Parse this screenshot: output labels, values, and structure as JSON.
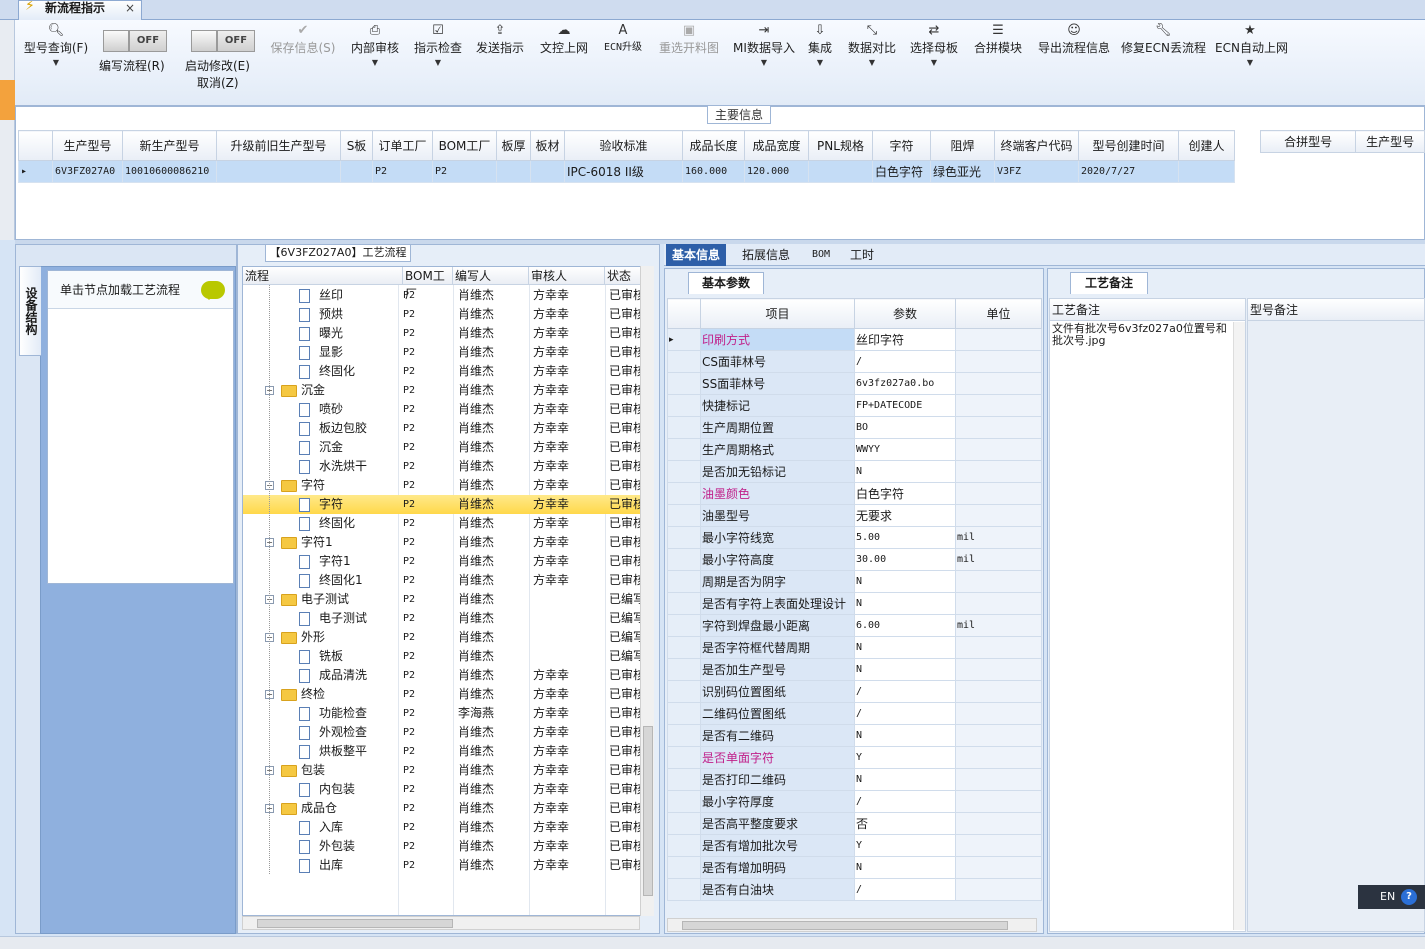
{
  "tab": {
    "title": "新流程指示",
    "close": "×"
  },
  "toolbar": {
    "query": "型号查询(F)",
    "edit_flow": "编写流程(R)",
    "auto_modify": "启动修改(E)",
    "cancel": "取消(Z)",
    "toggle_off": "OFF",
    "save": "保存信息(S)",
    "internal_review": "内部审核",
    "instruction_check": "指示检查",
    "send_instruction": "发送指示",
    "doc_control_upload": "文控上网",
    "ecn_upgrade": "ECN升级",
    "reselect_cut": "重选开料图",
    "mi_import": "MI数据导入",
    "integrate": "集成",
    "data_compare": "数据对比",
    "select_mother": "选择母板",
    "merge_module": "合拼模块",
    "export_flow": "导出流程信息",
    "fix_ecn_flow": "修复ECN丢流程",
    "ecn_auto_upload": "ECN自动上网"
  },
  "main_info": {
    "title": "主要信息",
    "columns": [
      "生产型号",
      "新生产型号",
      "升级前旧生产型号",
      "S板",
      "订单工厂",
      "BOM工厂",
      "板厚",
      "板材",
      "验收标准",
      "成品长度",
      "成品宽度",
      "PNL规格",
      "字符",
      "阻焊",
      "终端客户代码",
      "型号创建时间",
      "创建人"
    ],
    "row": [
      "6V3FZ027A0",
      "10010600086210",
      "",
      "",
      "P2",
      "P2",
      "",
      "",
      "IPC-6018 II级",
      "160.000",
      "120.000",
      "",
      "白色字符",
      "绿色亚光",
      "V3FZ",
      "2020/7/27",
      ""
    ],
    "side_columns": [
      "合拼型号",
      "生产型号"
    ]
  },
  "device": {
    "tab": "设备结构",
    "hint": "单击节点加载工艺流程"
  },
  "process": {
    "title": "【6V3FZ027A0】工艺流程",
    "columns": [
      "流程",
      "BOM工厂",
      "编写人",
      "审核人",
      "状态"
    ],
    "rows": [
      {
        "name": "丝印",
        "level": 2,
        "bom": "P2",
        "writer": "肖维杰",
        "reviewer": "方幸幸",
        "status": "已审核"
      },
      {
        "name": "预烘",
        "level": 2,
        "bom": "P2",
        "writer": "肖维杰",
        "reviewer": "方幸幸",
        "status": "已审核"
      },
      {
        "name": "曝光",
        "level": 2,
        "bom": "P2",
        "writer": "肖维杰",
        "reviewer": "方幸幸",
        "status": "已审核"
      },
      {
        "name": "显影",
        "level": 2,
        "bom": "P2",
        "writer": "肖维杰",
        "reviewer": "方幸幸",
        "status": "已审核"
      },
      {
        "name": "终固化",
        "level": 2,
        "bom": "P2",
        "writer": "肖维杰",
        "reviewer": "方幸幸",
        "status": "已审核"
      },
      {
        "name": "沉金",
        "level": 1,
        "bom": "P2",
        "writer": "肖维杰",
        "reviewer": "方幸幸",
        "status": "已审核"
      },
      {
        "name": "喷砂",
        "level": 2,
        "bom": "P2",
        "writer": "肖维杰",
        "reviewer": "方幸幸",
        "status": "已审核"
      },
      {
        "name": "板边包胶",
        "level": 2,
        "bom": "P2",
        "writer": "肖维杰",
        "reviewer": "方幸幸",
        "status": "已审核"
      },
      {
        "name": "沉金",
        "level": 2,
        "bom": "P2",
        "writer": "肖维杰",
        "reviewer": "方幸幸",
        "status": "已审核"
      },
      {
        "name": "水洗烘干",
        "level": 2,
        "bom": "P2",
        "writer": "肖维杰",
        "reviewer": "方幸幸",
        "status": "已审核"
      },
      {
        "name": "字符",
        "level": 1,
        "bom": "P2",
        "writer": "肖维杰",
        "reviewer": "方幸幸",
        "status": "已审核"
      },
      {
        "name": "字符",
        "level": 2,
        "bom": "P2",
        "writer": "肖维杰",
        "reviewer": "方幸幸",
        "status": "已审核",
        "selected": true
      },
      {
        "name": "终固化",
        "level": 2,
        "bom": "P2",
        "writer": "肖维杰",
        "reviewer": "方幸幸",
        "status": "已审核"
      },
      {
        "name": "字符1",
        "level": 1,
        "bom": "P2",
        "writer": "肖维杰",
        "reviewer": "方幸幸",
        "status": "已审核"
      },
      {
        "name": "字符1",
        "level": 2,
        "bom": "P2",
        "writer": "肖维杰",
        "reviewer": "方幸幸",
        "status": "已审核"
      },
      {
        "name": "终固化1",
        "level": 2,
        "bom": "P2",
        "writer": "肖维杰",
        "reviewer": "方幸幸",
        "status": "已审核"
      },
      {
        "name": "电子测试",
        "level": 1,
        "bom": "P2",
        "writer": "肖维杰",
        "reviewer": "",
        "status": "已编写"
      },
      {
        "name": "电子测试",
        "level": 2,
        "bom": "P2",
        "writer": "肖维杰",
        "reviewer": "",
        "status": "已编写"
      },
      {
        "name": "外形",
        "level": 1,
        "bom": "P2",
        "writer": "肖维杰",
        "reviewer": "",
        "status": "已编写"
      },
      {
        "name": "铣板",
        "level": 2,
        "bom": "P2",
        "writer": "肖维杰",
        "reviewer": "",
        "status": "已编写"
      },
      {
        "name": "成品清洗",
        "level": 2,
        "bom": "P2",
        "writer": "肖维杰",
        "reviewer": "方幸幸",
        "status": "已审核"
      },
      {
        "name": "终检",
        "level": 1,
        "bom": "P2",
        "writer": "肖维杰",
        "reviewer": "方幸幸",
        "status": "已审核"
      },
      {
        "name": "功能检查",
        "level": 2,
        "bom": "P2",
        "writer": "李海燕",
        "reviewer": "方幸幸",
        "status": "已审核"
      },
      {
        "name": "外观检查",
        "level": 2,
        "bom": "P2",
        "writer": "肖维杰",
        "reviewer": "方幸幸",
        "status": "已审核"
      },
      {
        "name": "烘板整平",
        "level": 2,
        "bom": "P2",
        "writer": "肖维杰",
        "reviewer": "方幸幸",
        "status": "已审核"
      },
      {
        "name": "包装",
        "level": 1,
        "bom": "P2",
        "writer": "肖维杰",
        "reviewer": "方幸幸",
        "status": "已审核"
      },
      {
        "name": "内包装",
        "level": 2,
        "bom": "P2",
        "writer": "肖维杰",
        "reviewer": "方幸幸",
        "status": "已审核"
      },
      {
        "name": "成品仓",
        "level": 1,
        "bom": "P2",
        "writer": "肖维杰",
        "reviewer": "方幸幸",
        "status": "已审核"
      },
      {
        "name": "入库",
        "level": 2,
        "bom": "P2",
        "writer": "肖维杰",
        "reviewer": "方幸幸",
        "status": "已审核"
      },
      {
        "name": "外包装",
        "level": 2,
        "bom": "P2",
        "writer": "肖维杰",
        "reviewer": "方幸幸",
        "status": "已审核"
      },
      {
        "name": "出库",
        "level": 2,
        "bom": "P2",
        "writer": "肖维杰",
        "reviewer": "方幸幸",
        "status": "已审核"
      }
    ]
  },
  "right_tabs": [
    "基本信息",
    "拓展信息",
    "BOM",
    "工时"
  ],
  "basic_params": {
    "tab": "基本参数",
    "columns": [
      "项目",
      "参数",
      "单位"
    ],
    "rows": [
      {
        "item": "印刷方式",
        "value": "丝印字符",
        "unit": "",
        "pink": true,
        "selected": true
      },
      {
        "item": "CS面菲林号",
        "value": "/",
        "unit": ""
      },
      {
        "item": "SS面菲林号",
        "value": "6v3fz027a0.bo",
        "unit": ""
      },
      {
        "item": "快捷标记",
        "value": "FP+DATECODE",
        "unit": ""
      },
      {
        "item": "生产周期位置",
        "value": "BO",
        "unit": ""
      },
      {
        "item": "生产周期格式",
        "value": "WWYY",
        "unit": ""
      },
      {
        "item": "是否加无铅标记",
        "value": "N",
        "unit": ""
      },
      {
        "item": "油墨颜色",
        "value": "白色字符",
        "unit": "",
        "pink": true
      },
      {
        "item": "油墨型号",
        "value": "无要求",
        "unit": ""
      },
      {
        "item": "最小字符线宽",
        "value": "5.00",
        "unit": "mil"
      },
      {
        "item": "最小字符高度",
        "value": "30.00",
        "unit": "mil"
      },
      {
        "item": "周期是否为阴字",
        "value": "N",
        "unit": ""
      },
      {
        "item": "是否有字符上表面处理设计",
        "value": "N",
        "unit": ""
      },
      {
        "item": "字符到焊盘最小距离",
        "value": "6.00",
        "unit": "mil"
      },
      {
        "item": "是否字符框代替周期",
        "value": "N",
        "unit": ""
      },
      {
        "item": "是否加生产型号",
        "value": "N",
        "unit": ""
      },
      {
        "item": "识别码位置图纸",
        "value": "/",
        "unit": ""
      },
      {
        "item": "二维码位置图纸",
        "value": "/",
        "unit": ""
      },
      {
        "item": "是否有二维码",
        "value": "N",
        "unit": ""
      },
      {
        "item": "是否单面字符",
        "value": "Y",
        "unit": "",
        "pink": true
      },
      {
        "item": "是否打印二维码",
        "value": "N",
        "unit": ""
      },
      {
        "item": "最小字符厚度",
        "value": "/",
        "unit": ""
      },
      {
        "item": "是否高平整度要求",
        "value": "否",
        "unit": ""
      },
      {
        "item": "是否有增加批次号",
        "value": "Y",
        "unit": ""
      },
      {
        "item": "是否有增加明码",
        "value": "N",
        "unit": ""
      },
      {
        "item": "是否有白油块",
        "value": "/",
        "unit": ""
      }
    ]
  },
  "notes": {
    "tab": "工艺备注",
    "col1": "工艺备注",
    "col2": "型号备注",
    "text": "文件有批次号6v3fz027a0位置号和批次号.jpg"
  },
  "lang": {
    "code": "EN",
    "help": "?"
  }
}
